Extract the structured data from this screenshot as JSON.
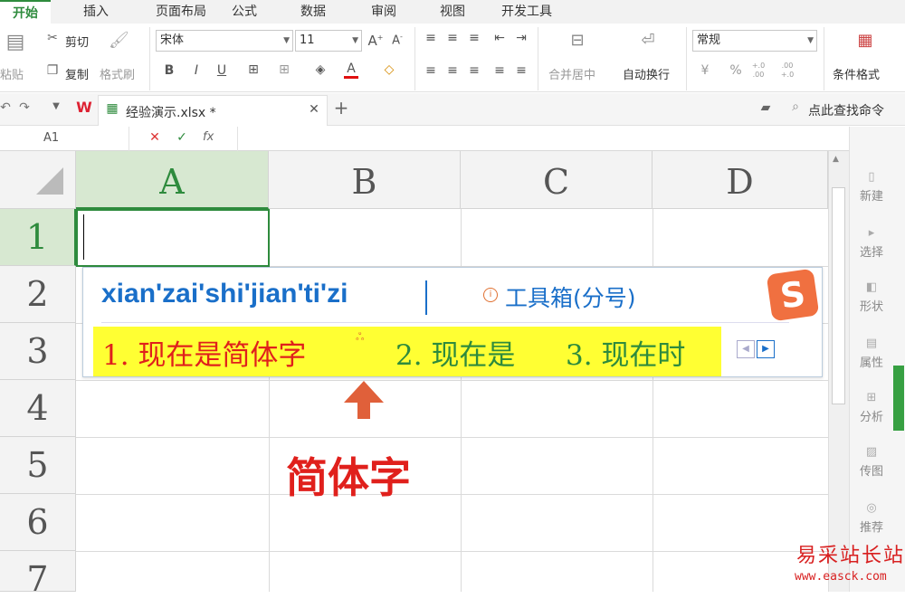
{
  "menu_tabs": [
    "开始",
    "插入",
    "页面布局",
    "公式",
    "数据",
    "审阅",
    "视图",
    "开发工具"
  ],
  "clipboard": {
    "paste": "粘贴",
    "cut": "剪切",
    "copy": "复制",
    "format_painter": "格式刷"
  },
  "font": {
    "name": "宋体",
    "size": "11",
    "bold": "B",
    "italic": "I",
    "underline": "U",
    "grow": "A",
    "shrink": "A",
    "color_letter": "A"
  },
  "alignment": {
    "merge": "合并居中",
    "wrap": "自动换行"
  },
  "number": {
    "format": "常规",
    "percent": "%",
    "inc": "+.0 .00",
    "dec": ".00 +.0"
  },
  "cond_format": "条件格式",
  "file_tab": {
    "name": "经验演示.xlsx *"
  },
  "search_cmd": "点此查找命令",
  "name_box": "A1",
  "fx": "fx",
  "columns": [
    "A",
    "B",
    "C",
    "D"
  ],
  "rows": [
    "1",
    "2",
    "3",
    "4",
    "5",
    "6",
    "7"
  ],
  "side_panel": [
    "新建",
    "选择",
    "形状",
    "属性",
    "分析",
    "传图",
    "推荐"
  ],
  "ime": {
    "pinyin": "xian'zai'shi'jian'ti'zi",
    "toolbox": "工具箱(分号)",
    "candidates": [
      "1. 现在是简体字",
      "2. 现在是",
      "3. 现在时"
    ]
  },
  "annotation": "简体字",
  "watermark": {
    "name": "易采站长站",
    "url": "www.easck.com"
  },
  "colors": {
    "accent": "#2e8b3d",
    "candidate_bg": "#ffff33",
    "annotation_red": "#e0201c",
    "arrow": "#e0603a",
    "pinyin_blue": "#1a6fc9"
  }
}
